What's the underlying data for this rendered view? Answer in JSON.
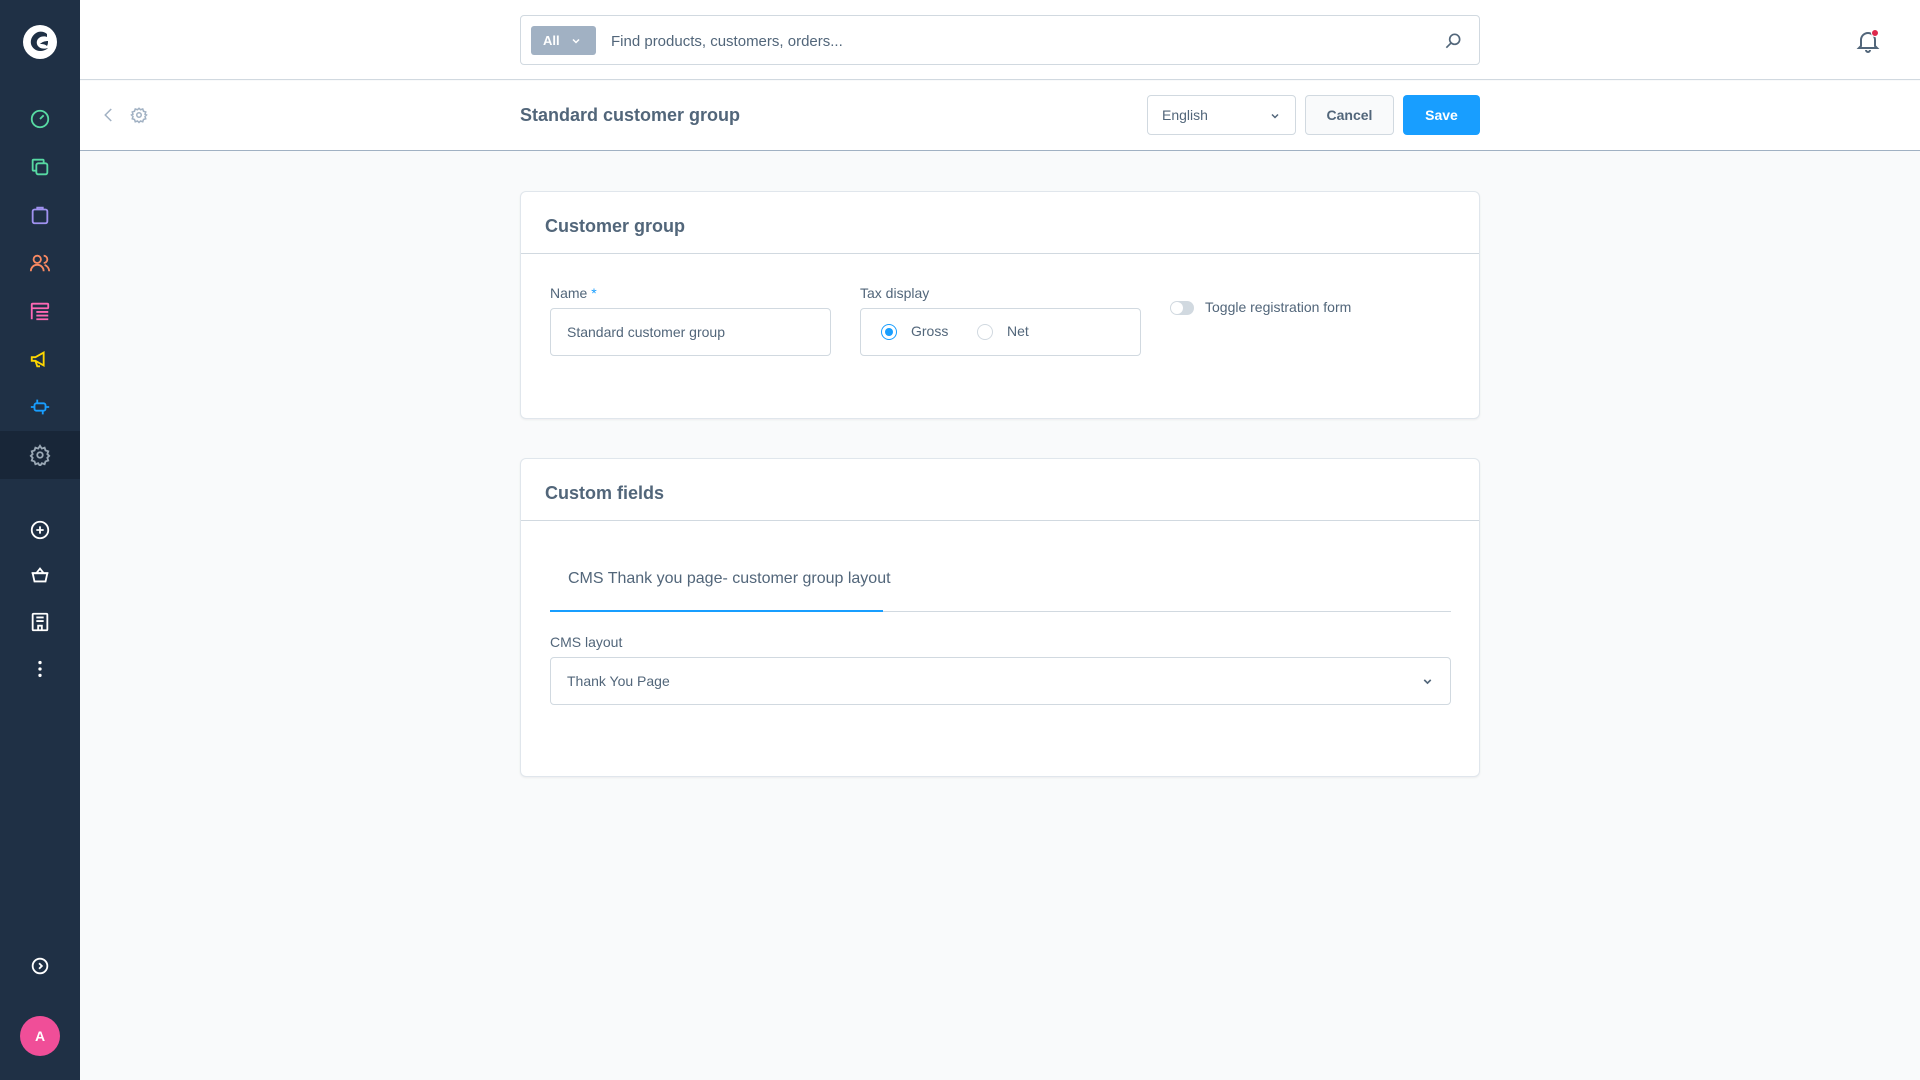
{
  "sidebar": {
    "items": [
      {
        "name": "dashboard-icon",
        "color": "#57d9a3"
      },
      {
        "name": "catalogues-icon",
        "color": "#57d9a3"
      },
      {
        "name": "orders-icon",
        "color": "#a092f0"
      },
      {
        "name": "customers-icon",
        "color": "#f88962"
      },
      {
        "name": "content-icon",
        "color": "#ff68b4"
      },
      {
        "name": "marketing-icon",
        "color": "#ffd700"
      },
      {
        "name": "extensions-icon",
        "color": "#189eff"
      },
      {
        "name": "settings-icon",
        "color": "#9aa8b5",
        "active": true
      },
      {
        "name": "add-sales-channel-icon",
        "color": "#ffffff"
      },
      {
        "name": "storefront-icon",
        "color": "#ffffff"
      },
      {
        "name": "headless-icon",
        "color": "#ffffff"
      },
      {
        "name": "more-icon",
        "color": "#ffffff"
      }
    ],
    "user_initial": "A"
  },
  "search": {
    "type_label": "All",
    "placeholder": "Find products, customers, orders..."
  },
  "smartbar": {
    "title": "Standard customer group",
    "language": "English",
    "cancel_label": "Cancel",
    "save_label": "Save"
  },
  "customer_group_card": {
    "title": "Customer group",
    "name_label": "Name",
    "name_required": "*",
    "name_value": "Standard customer group",
    "tax_label": "Tax display",
    "tax_options": [
      "Gross",
      "Net"
    ],
    "tax_selected": "Gross",
    "toggle_label": "Toggle registration form"
  },
  "custom_fields_card": {
    "title": "Custom fields",
    "tab_label": "CMS Thank you page- customer group layout",
    "cms_layout_label": "CMS layout",
    "cms_layout_value": "Thank You Page"
  },
  "colors": {
    "sidebar_bg": "#1f3045",
    "accent": "#189eff",
    "avatar": "#f04e98"
  }
}
